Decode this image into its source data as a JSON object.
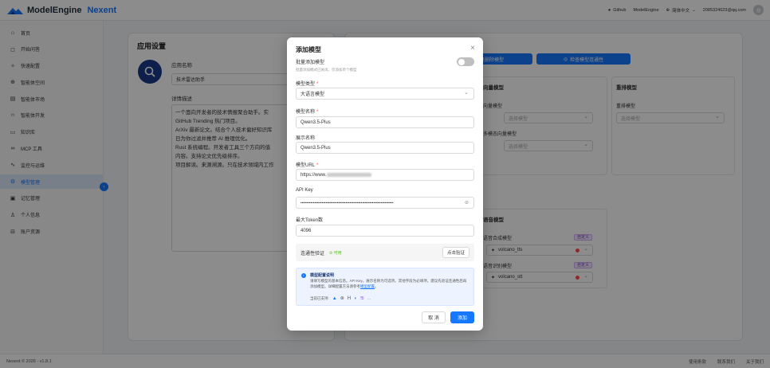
{
  "topbar": {
    "brand_main": "ModelEngine",
    "brand_sub": "Nexent",
    "github": "Github",
    "modelengine": "ModelEngine",
    "language": "简体中文",
    "email": "2085324623@qq.com"
  },
  "sidebar": {
    "items": [
      {
        "label": "首页",
        "icon": "home-icon"
      },
      {
        "label": "开始问答",
        "icon": "chat-icon"
      },
      {
        "label": "快速配置",
        "icon": "sparkle-icon"
      },
      {
        "label": "智能体空间",
        "icon": "globe-icon"
      },
      {
        "label": "智能体市场",
        "icon": "store-icon"
      },
      {
        "label": "智能体开发",
        "icon": "code-icon"
      },
      {
        "label": "知识库",
        "icon": "book-icon"
      },
      {
        "label": "MCP 工具",
        "icon": "link-icon"
      },
      {
        "label": "监控与运维",
        "icon": "pulse-icon"
      },
      {
        "label": "模型管理",
        "icon": "gear-icon",
        "active": true
      },
      {
        "label": "记忆管理",
        "icon": "memory-icon"
      },
      {
        "label": "个人信息",
        "icon": "user-icon"
      },
      {
        "label": "账户资源",
        "icon": "lock-icon"
      }
    ]
  },
  "app_settings": {
    "title": "应用设置",
    "name_label": "应用名称",
    "name_value": "技术雷达助手",
    "desc_label": "详情描述",
    "desc_lines": [
      "一个面向开发者的技术情报聚合助手。实",
      "GitHub Trending 热门项目。",
      "ArXiv 最新论文。结合个人技术偏好知识库",
      "日为你过滤并推荐 AI 推理优化。",
      "Rust 系统编程。开发者工具三个方向的值",
      "内容。支持论文优先级排序。",
      "项目解读。来源溯源。只在技术领域内工作"
    ]
  },
  "model_config": {
    "batch_delete": "批量删除模型",
    "check_conn": "检查模型连通性",
    "vector_section": "向量模型",
    "vector_label": "向量模型",
    "multimodal_vector_label": "多模态向量模型",
    "rerank_section": "重排模型",
    "rerank_label": "重排模型",
    "placeholder": "选择模型",
    "voice_section": "语音模型",
    "tts_label": "语音合成模型",
    "stt_label": "语音识别模型",
    "tts_value": "volcano_tts",
    "stt_value": "volcano_stt",
    "custom_tag": "自定义"
  },
  "modal": {
    "title": "添加模型",
    "batch_label": "批量添加模型",
    "batch_hint": "批量添加模式已关闭。仅添加单个模型",
    "type_label": "模型类型",
    "type_value": "大语言模型",
    "name_label": "模型名称",
    "name_value": "Qwen3.5-Plus",
    "display_label": "展示名称",
    "display_value": "Qwen3.5-Plus",
    "url_label": "模型URL",
    "url_value": "https://www.",
    "apikey_label": "API Key",
    "apikey_value": "••••••••••••••••••••••••••••••••••••••••••••••••••••••••••••••••••••••••••",
    "token_label": "最大Token数",
    "token_value": "4096",
    "conn_label": "连通性验证",
    "conn_status": "可用",
    "verify_button": "点击验证",
    "info_title": "模型配置说明",
    "info_desc_1": "请填写模型的基本信息。API Key。展示名称为可选项。其他字段为必填项。建议先验证连通性后再添加模型。详细配置方法请参考",
    "info_link": "模型配置",
    "info_desc_2": "。",
    "supported_label": "当前已支持:",
    "more": "...",
    "cancel": "取 消",
    "add": "添加"
  },
  "footer": {
    "copyright": "Nexent © 2026 · v1.8.1",
    "terms": "使用条款",
    "contact": "联系我们",
    "about": "关于我们"
  }
}
